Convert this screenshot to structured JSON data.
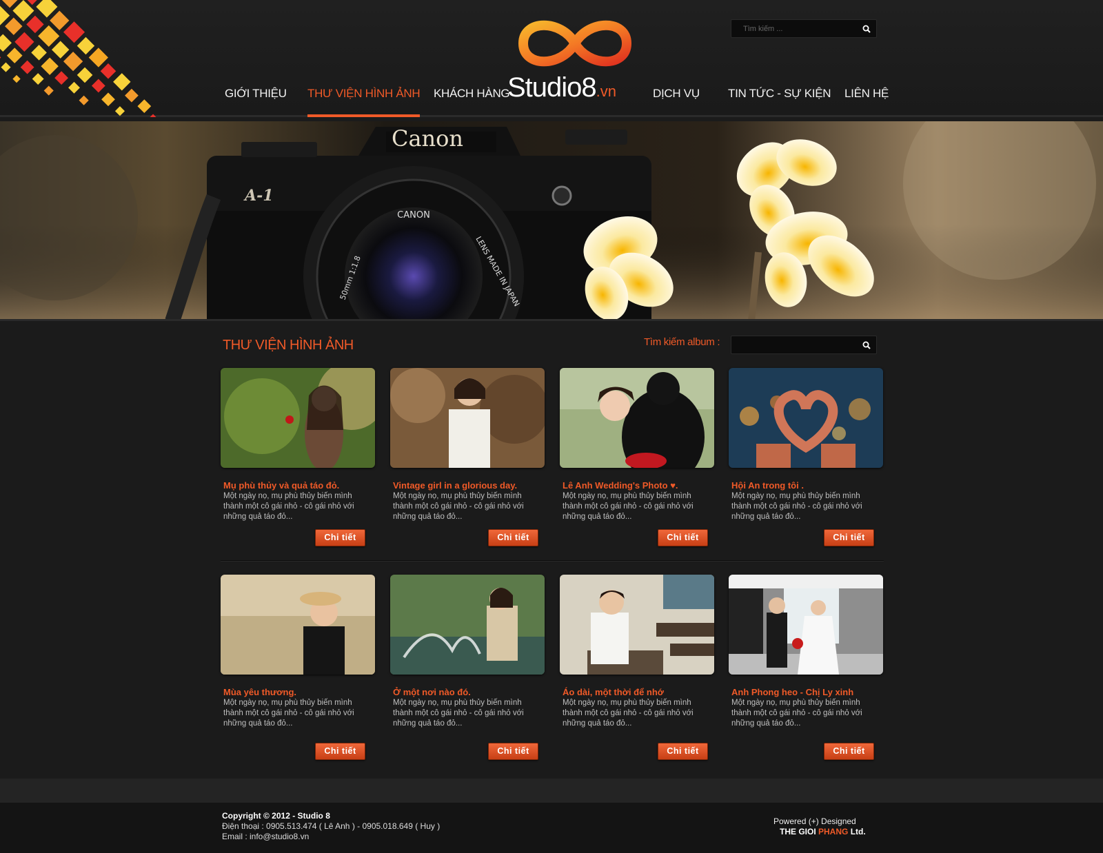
{
  "header": {
    "logo_text": "Studio8",
    "logo_suffix": ".vn",
    "search": {
      "placeholder": "Tìm kiếm ..."
    }
  },
  "nav": {
    "items": [
      {
        "label": "GIỚI THIỆU"
      },
      {
        "label": "THƯ VIỆN HÌNH ẢNH",
        "active": true
      },
      {
        "label": "KHÁCH HÀNG"
      },
      {
        "label": "DỊCH VỤ"
      },
      {
        "label": "TIN TỨC - SỰ KIỆN"
      },
      {
        "label": "LIÊN HỆ"
      }
    ]
  },
  "banner": {
    "camera_brand": "Canon",
    "camera_model": "A-1",
    "lens_brand": "CANON",
    "lens_text": "LENS MADE IN JAPAN",
    "lens_spec": "50mm 1:1.8"
  },
  "gallery": {
    "title": "THƯ VIỆN HÌNH ẢNH",
    "album_search_label": "Tìm kiếm album :",
    "button_label": "Chi tiết",
    "albums": [
      {
        "title": "Mụ phù thủy và quả táo đỏ.",
        "desc": "Một ngày nọ, mụ phù thủy biến mình thành một cô gái nhỏ - cô gái nhỏ với những quả táo đỏ..."
      },
      {
        "title": "Vintage girl in a glorious day.",
        "desc": "Một ngày nọ, mụ phù thủy biến mình thành một cô gái nhỏ - cô gái nhỏ với những quả táo đỏ..."
      },
      {
        "title": "Lê Anh Wedding's Photo ♥.",
        "desc": "Một ngày nọ, mụ phù thủy biến mình thành một cô gái nhỏ - cô gái nhỏ với những quả táo đỏ..."
      },
      {
        "title": "Hội An trong tôi .",
        "desc": "Một ngày nọ, mụ phù thủy biến mình thành một cô gái nhỏ - cô gái nhỏ với những quả táo đỏ..."
      },
      {
        "title": "Mùa yêu thương.",
        "desc": "Một ngày nọ, mụ phù thủy biến mình thành một cô gái nhỏ - cô gái nhỏ với những quả táo đỏ..."
      },
      {
        "title": "Ở một nơi nào đó.",
        "desc": "Một ngày nọ, mụ phù thủy biến mình thành một cô gái nhỏ - cô gái nhỏ với những quả táo đỏ..."
      },
      {
        "title": "Áo dài, một thời để nhớ",
        "desc": "Một ngày nọ, mụ phù thủy biến mình thành một cô gái nhỏ - cô gái nhỏ với những quả táo đỏ..."
      },
      {
        "title": "Anh Phong heo - Chị Ly xinh",
        "desc": "Một ngày nọ, mụ phù thủy biến mình thành một cô gái nhỏ - cô gái nhỏ với những quả táo đỏ..."
      }
    ]
  },
  "footer": {
    "copyright": "Copyright © 2012 - Studio 8",
    "phone": "Điện thoại    : 0905.513.474 ( Lê Anh ) - 0905.018.649 ( Huy )",
    "email": "Email : info@studio8.vn",
    "powered": "Powered (+) Designed",
    "company_prefix": "THE GIOI ",
    "company_highlight": "PHANG",
    "company_suffix": " Ltd."
  },
  "colors": {
    "accent": "#f05a28",
    "background": "#1b1b1b",
    "button": "#d9532a"
  },
  "icons": {
    "search": "search-icon",
    "logo": "infinity-logo-icon"
  }
}
